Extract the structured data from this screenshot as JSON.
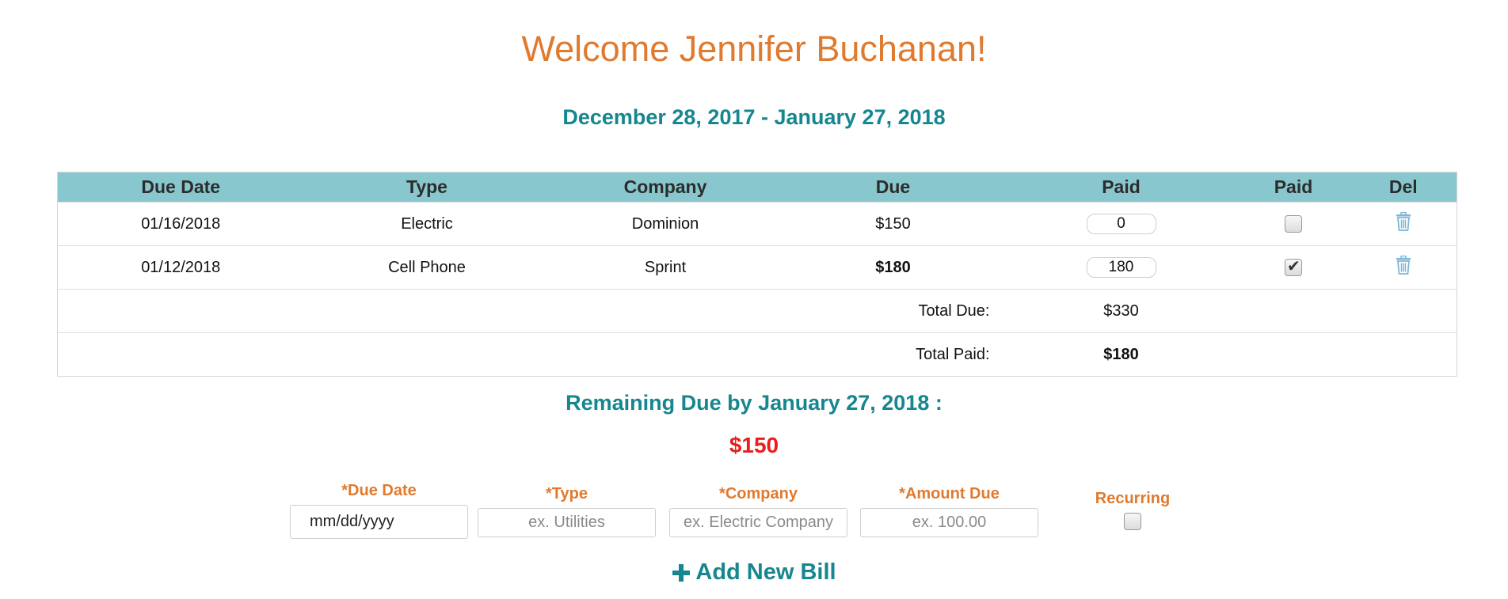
{
  "header": {
    "welcome": "Welcome Jennifer Buchanan!",
    "date_range": "December 28, 2017 - January 27, 2018"
  },
  "table": {
    "columns": [
      "Due Date",
      "Type",
      "Company",
      "Due",
      "Paid",
      "Paid",
      "Del"
    ],
    "rows": [
      {
        "due_date": "01/16/2018",
        "type": "Electric",
        "company": "Dominion",
        "due": "$150",
        "paid_amount": "0",
        "paid_checked": false
      },
      {
        "due_date": "01/12/2018",
        "type": "Cell Phone",
        "company": "Sprint",
        "due": "$180",
        "paid_amount": "180",
        "paid_checked": true
      }
    ],
    "total_due_label": "Total Due:",
    "total_due_value": "$330",
    "total_paid_label": "Total Paid:",
    "total_paid_value": "$180"
  },
  "remaining": {
    "label": "Remaining Due by January 27, 2018 :",
    "value": "$150"
  },
  "form": {
    "due_date_label": "*Due Date",
    "due_date_placeholder": "mm/dd/yyyy",
    "type_label": "*Type",
    "type_placeholder": "ex. Utilities",
    "company_label": "*Company",
    "company_placeholder": "ex. Electric Company",
    "amount_label": "*Amount Due",
    "amount_placeholder": "ex. 100.00",
    "recurring_label": "Recurring",
    "add_label": "Add New Bill"
  },
  "icons": {
    "delete": "trash-icon",
    "add": "plus-icon",
    "check": "checkmark-icon"
  },
  "colors": {
    "accent_orange": "#e07a2e",
    "accent_teal": "#16868f",
    "header_bg": "#88c7ce",
    "unpaid_red": "#e81e1e",
    "paid_green": "#1d7a1d"
  }
}
